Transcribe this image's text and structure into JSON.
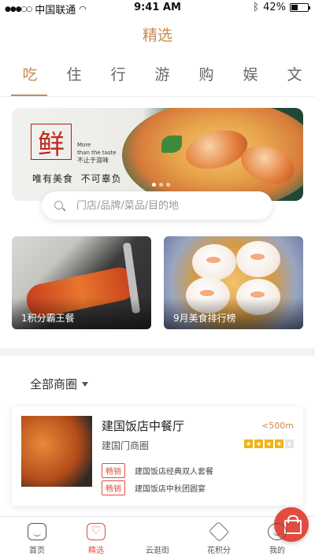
{
  "status_bar": {
    "carrier": "中国联通",
    "time": "9:41 AM",
    "battery": "42%",
    "battery_level": 0.42
  },
  "header": {
    "title": "精选"
  },
  "tabs": [
    {
      "label": "吃",
      "active": true
    },
    {
      "label": "住"
    },
    {
      "label": "行"
    },
    {
      "label": "游"
    },
    {
      "label": "购"
    },
    {
      "label": "娱"
    },
    {
      "label": "文"
    }
  ],
  "banner": {
    "seal_char": "鲜",
    "more_line1": "More",
    "more_line2": "than the taste",
    "subtitle": "不止于滋味",
    "slogan": "唯有美食  不可辜负"
  },
  "search": {
    "placeholder": "门店/品牌/菜品/目的地"
  },
  "promo_cards": [
    {
      "label": "1积分霸王餐"
    },
    {
      "label": "9月美食排行榜"
    }
  ],
  "filter": {
    "label": "全部商圈"
  },
  "restaurant": {
    "name": "建国饭店中餐厅",
    "distance": "<500m",
    "area": "建国门商圈",
    "rating": 4,
    "rating_max": 5,
    "deals": [
      {
        "tag": "畅销",
        "text": "建国饭店经典双人套餐"
      },
      {
        "tag": "畅销",
        "text": "建国饭店中秋团圆宴"
      }
    ]
  },
  "nav": {
    "items": [
      {
        "label": "首页",
        "icon": "home-icon"
      },
      {
        "label": "精选",
        "icon": "heart-icon",
        "active": true
      },
      {
        "label": "云逛街",
        "icon": "shopping-bag-icon"
      },
      {
        "label": "花积分",
        "icon": "diamond-icon"
      },
      {
        "label": "我的",
        "icon": "smiley-icon"
      }
    ]
  },
  "colors": {
    "accent": "#c98a4f",
    "red": "#e24c3f",
    "star": "#f2b318"
  }
}
